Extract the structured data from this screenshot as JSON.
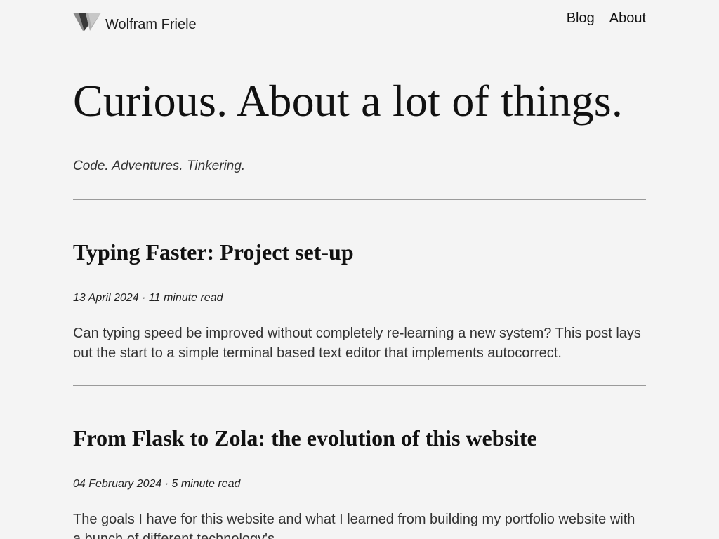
{
  "site": {
    "name": "Wolfram Friele",
    "logo_icon": "wf-logo-icon"
  },
  "nav": {
    "items": [
      {
        "label": "Blog"
      },
      {
        "label": "About"
      }
    ]
  },
  "hero": {
    "title": "Curious. About a lot of things.",
    "tagline": "Code. Adventures. Tinkering."
  },
  "posts": [
    {
      "title": "Typing Faster: Project set-up",
      "date": "13 April 2024",
      "read_time": "11 minute read",
      "meta": "13 April 2024 · 11 minute read",
      "excerpt": "Can typing speed be improved without completely re-learning a new system? This post lays out the start to a simple terminal based text editor that implements autocorrect."
    },
    {
      "title": "From Flask to Zola: the evolution of this website",
      "date": "04 February 2024",
      "read_time": "5 minute read",
      "meta": "04 February 2024 · 5 minute read",
      "excerpt": "The goals I have for this website and what I learned from building my portfolio website with a bunch of different technology's."
    }
  ],
  "colors": {
    "background": "#f4f4f4",
    "text": "#1a1a1a",
    "rule": "#9a9a9a"
  }
}
